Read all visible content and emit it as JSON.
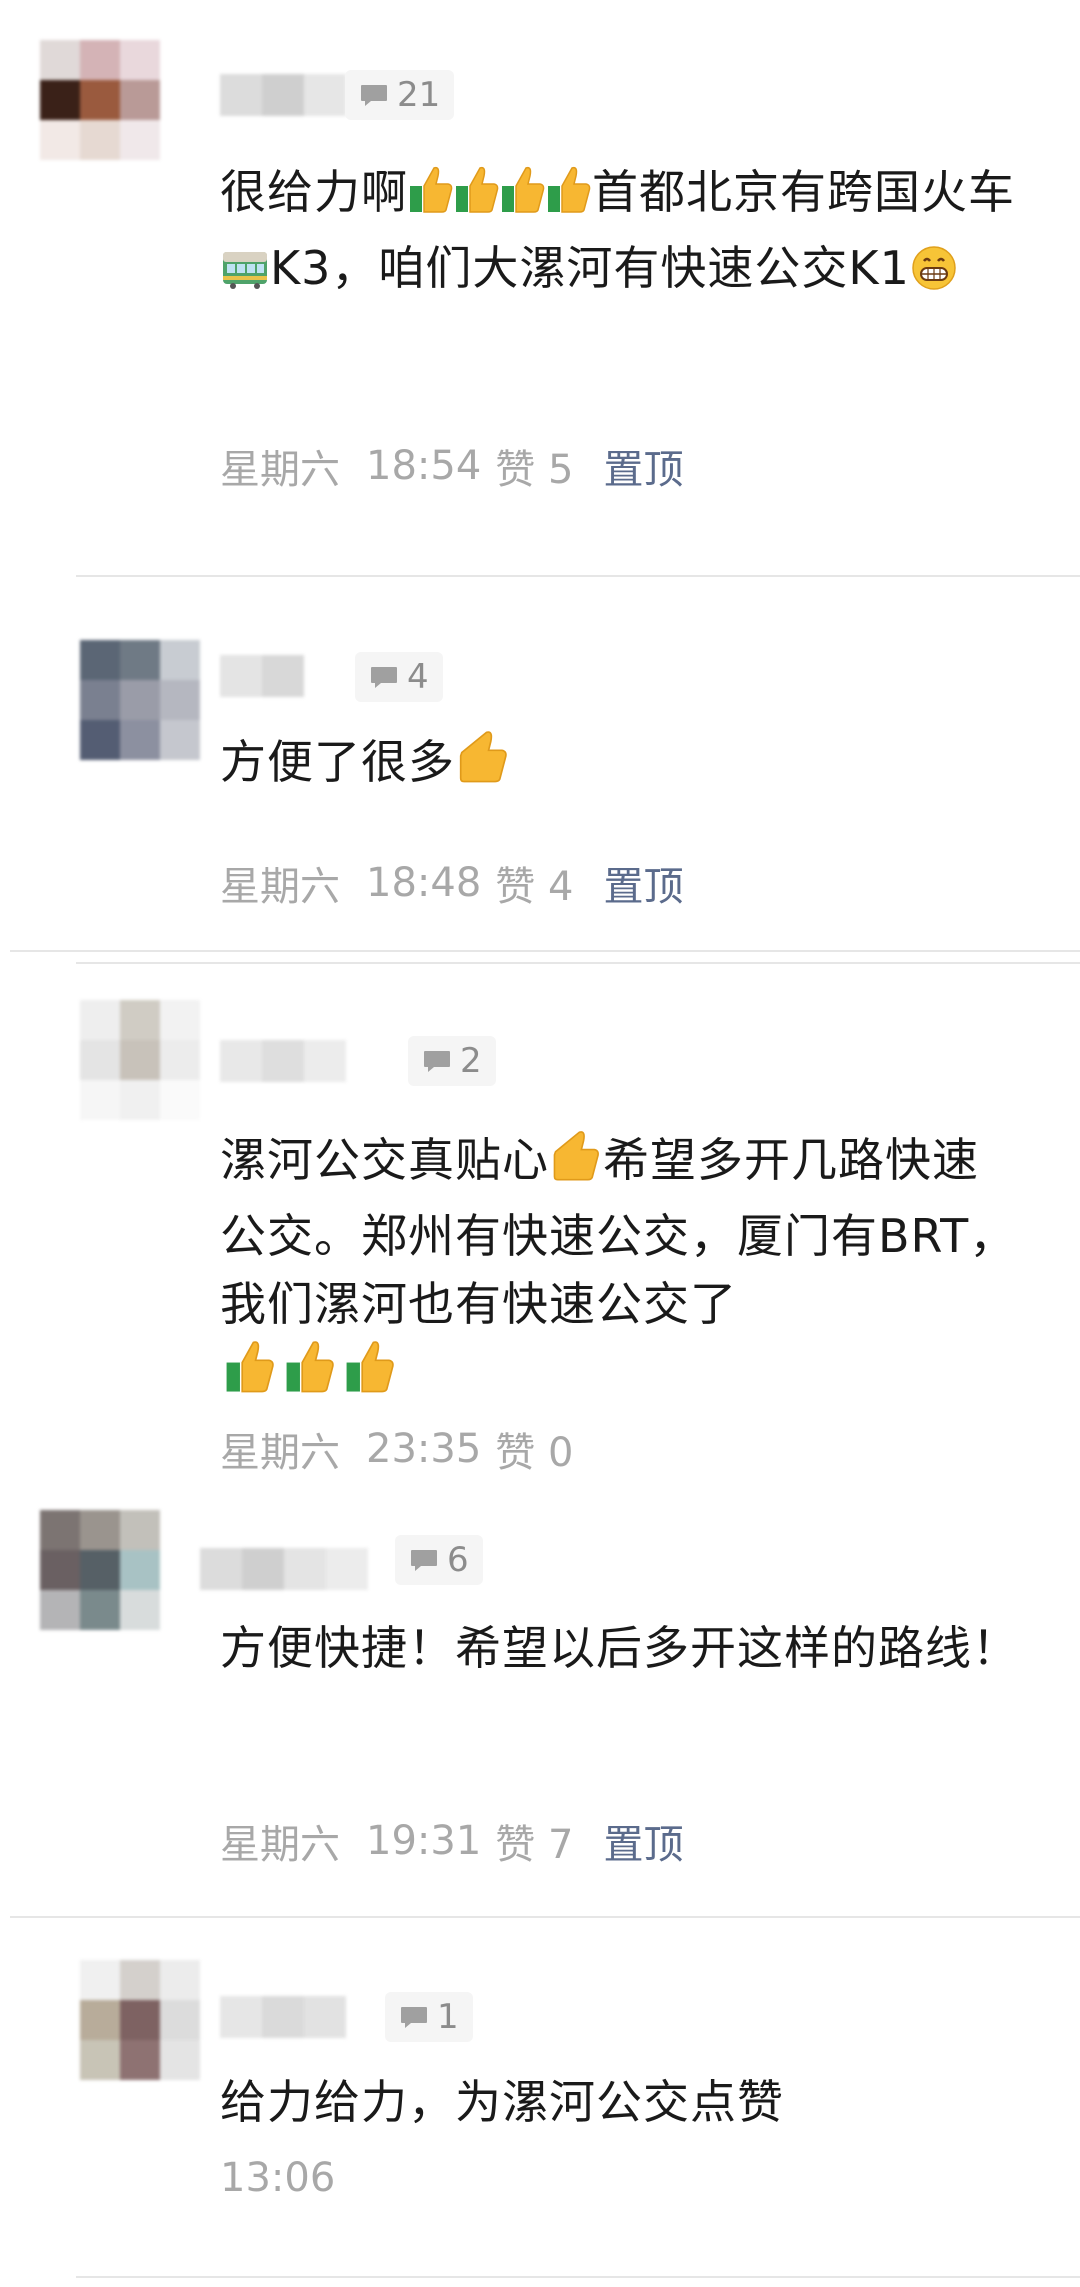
{
  "comments": [
    {
      "reply_count": "21",
      "text_parts": [
        "很给力啊",
        "👍",
        "👍",
        "👍",
        "👍",
        "首都北京有跨国火车",
        "🚃",
        "K3，咱们大漯河有快速公交K1",
        "😁"
      ],
      "day": "星期六",
      "time": "18:54",
      "likes_label": "赞 5",
      "pin_label": "置顶"
    },
    {
      "reply_count": "4",
      "text": "方便了很多",
      "day": "星期六",
      "time": "18:48",
      "likes_label": "赞 4",
      "pin_label": "置顶"
    },
    {
      "reply_count": "2",
      "text_a": "漯河公交真贴心",
      "text_b": "希望多开几路快速公交。郑州有快速公交，厦门有BRT，我们漯河也有快速公交了",
      "day": "星期六",
      "time": "23:35",
      "likes_label": "赞 0"
    },
    {
      "reply_count": "6",
      "text": "方便快捷！希望以后多开这样的路线！",
      "day": "星期六",
      "time": "19:31",
      "likes_label": "赞 7",
      "pin_label": "置顶"
    },
    {
      "reply_count": "1",
      "text": "给力给力，为漯河公交点赞",
      "time": "13:06"
    }
  ],
  "colors": {
    "meta": "#a8a8a8",
    "pin_link": "#5b6b8c",
    "divider": "#e6e6e6",
    "badge_bg": "#f5f5f5"
  },
  "icons": {
    "reply": "comment-bubble-icon",
    "emoji_like": "thumbs-up-icon",
    "emoji_train": "tram-car-icon",
    "emoji_grin": "grinning-face-icon"
  }
}
